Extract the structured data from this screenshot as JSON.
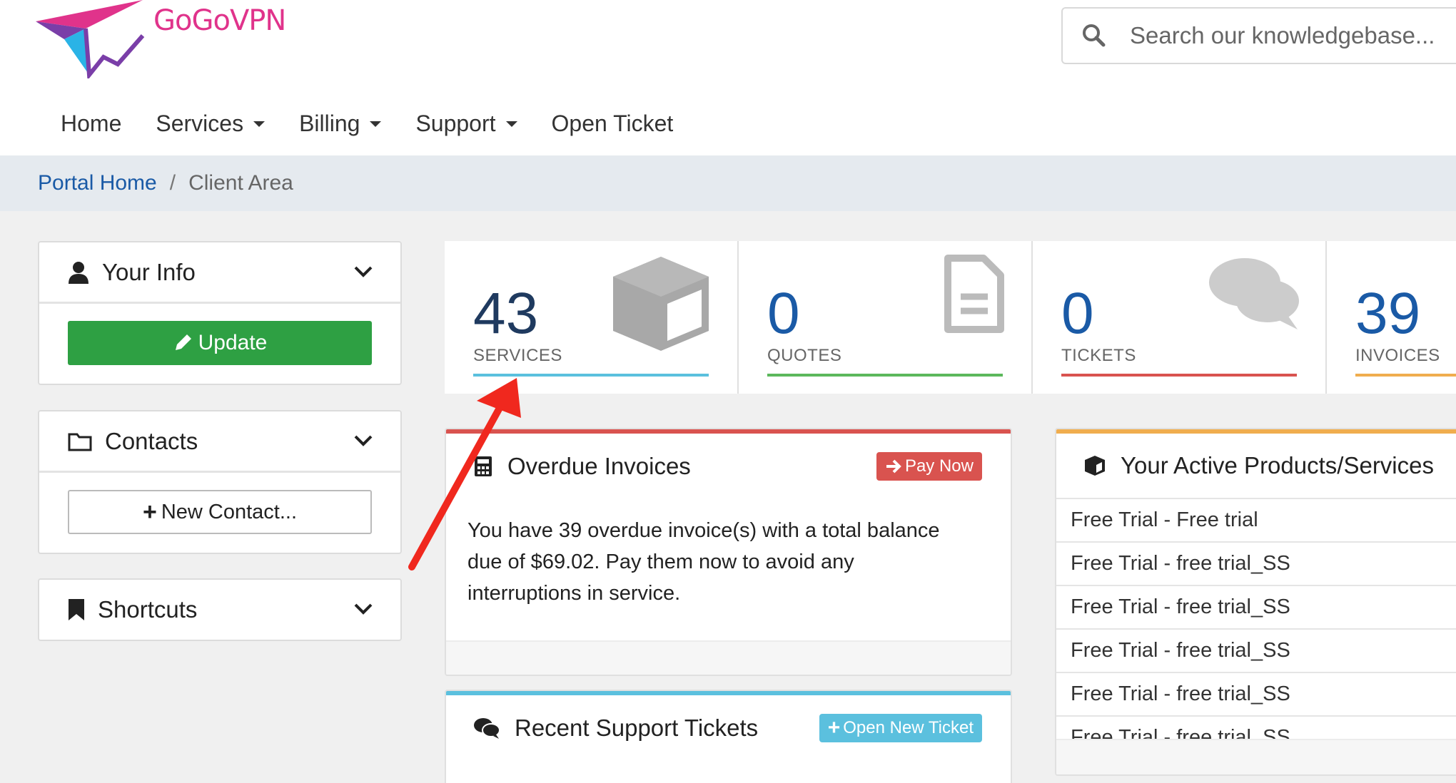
{
  "brand": {
    "name": "GoGoVPN"
  },
  "search": {
    "placeholder": "Search our knowledgebase..."
  },
  "nav": [
    {
      "label": "Home",
      "dropdown": false
    },
    {
      "label": "Services",
      "dropdown": true
    },
    {
      "label": "Billing",
      "dropdown": true
    },
    {
      "label": "Support",
      "dropdown": true
    },
    {
      "label": "Open Ticket",
      "dropdown": false
    }
  ],
  "breadcrumb": {
    "home": "Portal Home",
    "separator": "/",
    "current": "Client Area"
  },
  "sidebar": {
    "your_info": {
      "title": "Your Info",
      "button": "Update"
    },
    "contacts": {
      "title": "Contacts",
      "button": "New Contact..."
    },
    "shortcuts": {
      "title": "Shortcuts"
    }
  },
  "stats": [
    {
      "value": "43",
      "label": "SERVICES",
      "color": "#5bc0de"
    },
    {
      "value": "0",
      "label": "QUOTES",
      "color": "#5cb85c"
    },
    {
      "value": "0",
      "label": "TICKETS",
      "color": "#d9534f"
    },
    {
      "value": "39",
      "label": "INVOICES",
      "color": "#f0ad4e"
    }
  ],
  "overdue": {
    "title": "Overdue Invoices",
    "button": "Pay Now",
    "line1": "You have 39 overdue invoice(s) with a total balance",
    "line2": "due of $69.02. Pay them now to avoid any",
    "line3": "interruptions in service."
  },
  "tickets": {
    "title": "Recent Support Tickets",
    "button": "Open New Ticket"
  },
  "products": {
    "title": "Your Active Products/Services",
    "items": [
      "Free Trial - Free trial",
      "Free Trial - free trial_SS",
      "Free Trial - free trial_SS",
      "Free Trial - free trial_SS",
      "Free Trial - free trial_SS",
      "Free Trial - free trial_SS"
    ]
  }
}
